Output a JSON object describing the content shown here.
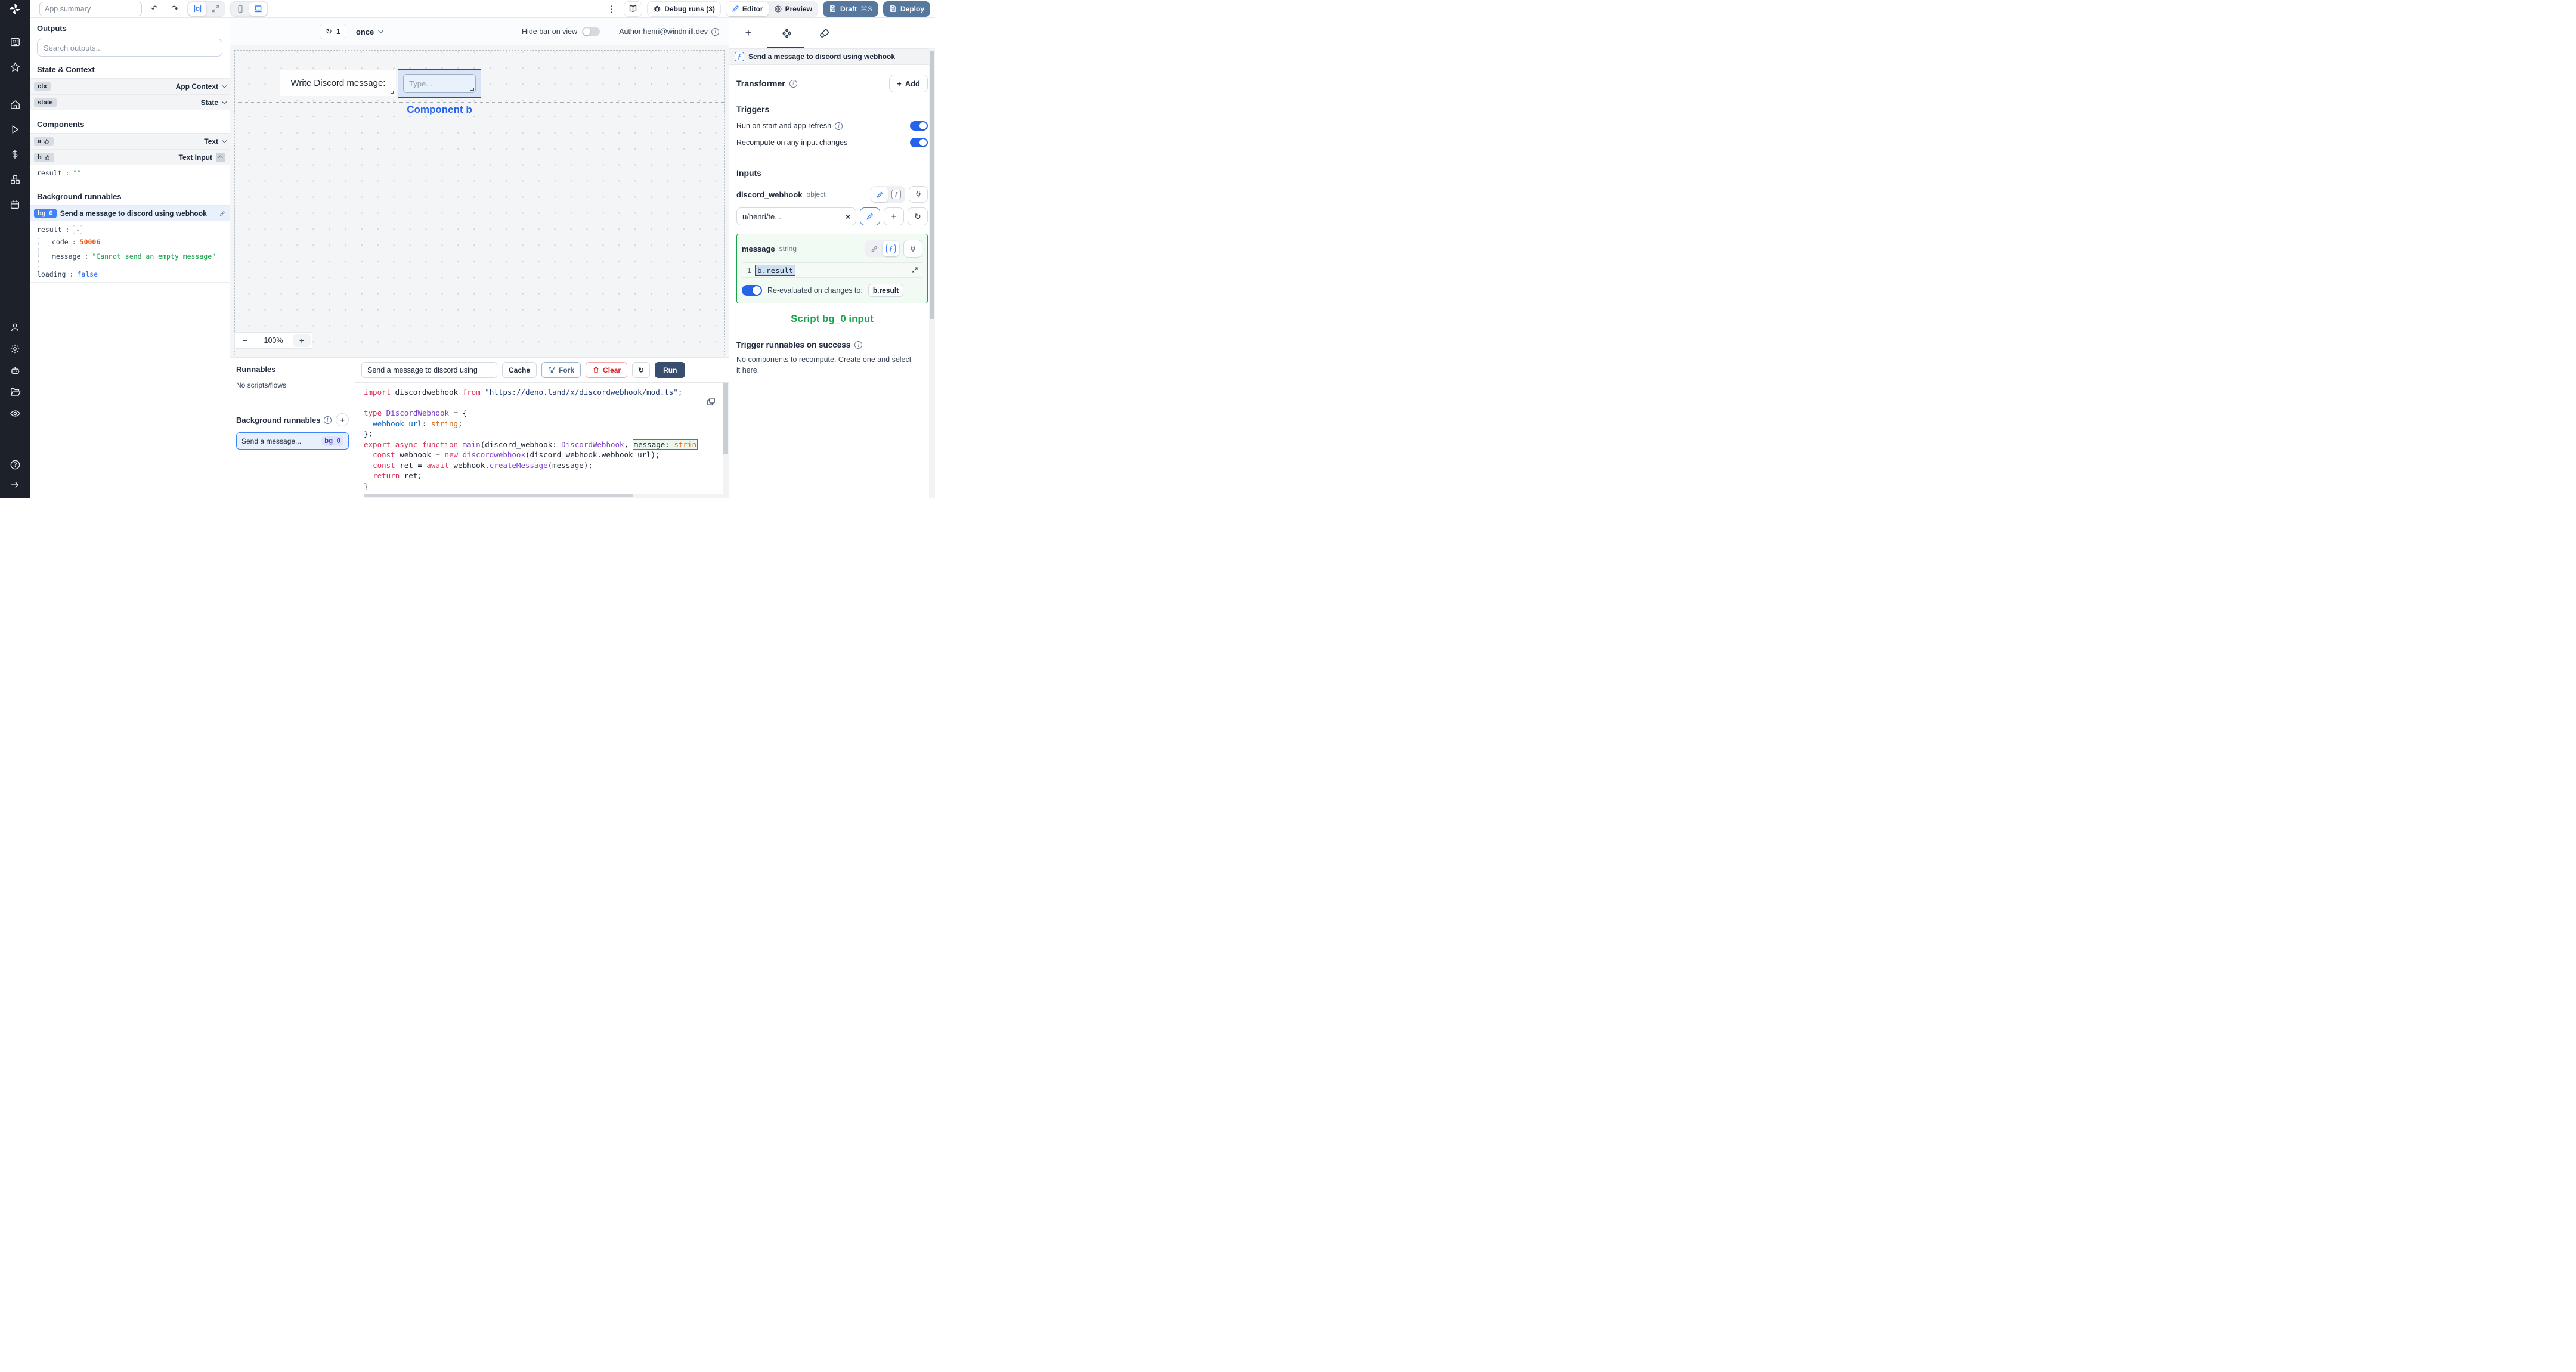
{
  "colors": {
    "accent_blue": "#3b82f6",
    "selection_blue": "#1d4ed8",
    "steel_button": "#56779e",
    "run_button": "#394e6e",
    "success_green": "#16a34a",
    "error_orange": "#e8590c",
    "rail_bg": "#1d212a",
    "keyword_red": "#dd2e57",
    "purple": "#7f3fd0"
  },
  "topbar": {
    "summary_placeholder": "App summary",
    "debug_label": "Debug runs (3)",
    "editor_label": "Editor",
    "preview_label": "Preview",
    "draft_label": "Draft",
    "draft_shortcut": "⌘S",
    "deploy_label": "Deploy"
  },
  "outputs": {
    "title": "Outputs",
    "search_placeholder": "Search outputs...",
    "state_context_title": "State & Context",
    "ctx_key": "ctx",
    "ctx_type": "App Context",
    "state_key": "state",
    "state_type": "State",
    "components_title": "Components",
    "a_key": "a",
    "a_type": "Text",
    "b_key": "b",
    "b_type": "Text Input",
    "b_result_key": "result",
    "b_result_sep": ":",
    "b_result_value": "\"\"",
    "background_title": "Background runnables",
    "bg_badge": "bg_0",
    "bg_name": "Send a message to discord using webhook",
    "result_key": "result",
    "result_sep": ":",
    "result_toggle": "-",
    "code_key": "code",
    "code_sep": ":",
    "code_value": "50006",
    "message_key": "message",
    "message_sep": ":",
    "message_value": "\"Cannot send an empty message\"",
    "loading_key": "loading",
    "loading_sep": ":",
    "loading_value": "false"
  },
  "canvas": {
    "refresh_count": "1",
    "schedule": "once",
    "hide_bar_label": "Hide bar on view",
    "author_label": "Author henri@windmill.dev",
    "comp_a_text": "Write Discord message:",
    "comp_b_placeholder": "Type...",
    "comp_b_label": "Component b",
    "zoom_minus": "−",
    "zoom_level": "100%",
    "zoom_plus": "+"
  },
  "runnables": {
    "title": "Runnables",
    "empty": "No scripts/flows",
    "background_title": "Background runnables",
    "item_name": "Send a message...",
    "item_badge": "bg_0"
  },
  "code_editor": {
    "name_field": "Send a message to discord using",
    "cache_label": "Cache",
    "fork_label": "Fork",
    "clear_label": "Clear",
    "run_label": "Run",
    "lines": [
      [
        {
          "c": "kw",
          "t": "import"
        },
        {
          "c": "plain",
          "t": " discordwebhook "
        },
        {
          "c": "kw",
          "t": "from"
        },
        {
          "c": "plain",
          "t": " "
        },
        {
          "c": "str",
          "t": "\"https://deno.land/x/discordwebhook/mod.ts\""
        },
        {
          "c": "plain",
          "t": ";"
        }
      ],
      [],
      [
        {
          "c": "kw",
          "t": "type"
        },
        {
          "c": "plain",
          "t": " "
        },
        {
          "c": "id",
          "t": "DiscordWebhook"
        },
        {
          "c": "plain",
          "t": " = {"
        }
      ],
      [
        {
          "c": "plain",
          "t": "  "
        },
        {
          "c": "prop",
          "t": "webhook_url"
        },
        {
          "c": "plain",
          "t": ": "
        },
        {
          "c": "typ",
          "t": "string"
        },
        {
          "c": "plain",
          "t": ";"
        }
      ],
      [
        {
          "c": "plain",
          "t": "};"
        }
      ],
      [
        {
          "c": "kw",
          "t": "export"
        },
        {
          "c": "plain",
          "t": " "
        },
        {
          "c": "kw",
          "t": "async"
        },
        {
          "c": "plain",
          "t": " "
        },
        {
          "c": "kw",
          "t": "function"
        },
        {
          "c": "plain",
          "t": " "
        },
        {
          "c": "fn",
          "t": "main"
        },
        {
          "c": "plain",
          "t": "(discord_webhook: "
        },
        {
          "c": "id",
          "t": "DiscordWebhook"
        },
        {
          "c": "plain",
          "t": ", "
        },
        {
          "c": "plain",
          "t": "message: ",
          "h": true
        },
        {
          "c": "typ",
          "t": "strin",
          "h": true
        }
      ],
      [
        {
          "c": "plain",
          "t": "  "
        },
        {
          "c": "kw",
          "t": "const"
        },
        {
          "c": "plain",
          "t": " webhook = "
        },
        {
          "c": "kw",
          "t": "new"
        },
        {
          "c": "plain",
          "t": " "
        },
        {
          "c": "id",
          "t": "discordwebhook"
        },
        {
          "c": "plain",
          "t": "(discord_webhook.webhook_url);"
        }
      ],
      [
        {
          "c": "plain",
          "t": "  "
        },
        {
          "c": "kw",
          "t": "const"
        },
        {
          "c": "plain",
          "t": " ret = "
        },
        {
          "c": "kw",
          "t": "await"
        },
        {
          "c": "plain",
          "t": " webhook."
        },
        {
          "c": "fn",
          "t": "createMessage"
        },
        {
          "c": "plain",
          "t": "(message);"
        }
      ],
      [
        {
          "c": "plain",
          "t": "  "
        },
        {
          "c": "kw",
          "t": "return"
        },
        {
          "c": "plain",
          "t": " ret;"
        }
      ],
      [
        {
          "c": "plain",
          "t": "}"
        }
      ]
    ]
  },
  "right_panel": {
    "header": "Send a message to discord using webhook",
    "f_glyph": "ƒ",
    "transformer_label": "Transformer",
    "add_label": "Add",
    "triggers_title": "Triggers",
    "run_on_start_label": "Run on start and app refresh",
    "recompute_label": "Recompute on any input changes",
    "inputs_title": "Inputs",
    "dw_name": "discord_webhook",
    "dw_type": "object",
    "dw_value": "u/henri/te...",
    "msg_name": "message",
    "msg_type": "string",
    "msg_line_no": "1",
    "msg_expr": "b.result",
    "reeval_label": "Re-evaluated on changes to:",
    "reeval_target": "b.result",
    "script_input_label": "Script bg_0 input",
    "trigger_success_title": "Trigger runnables on success",
    "trigger_success_empty": "No components to recompute. Create one and select it here."
  }
}
